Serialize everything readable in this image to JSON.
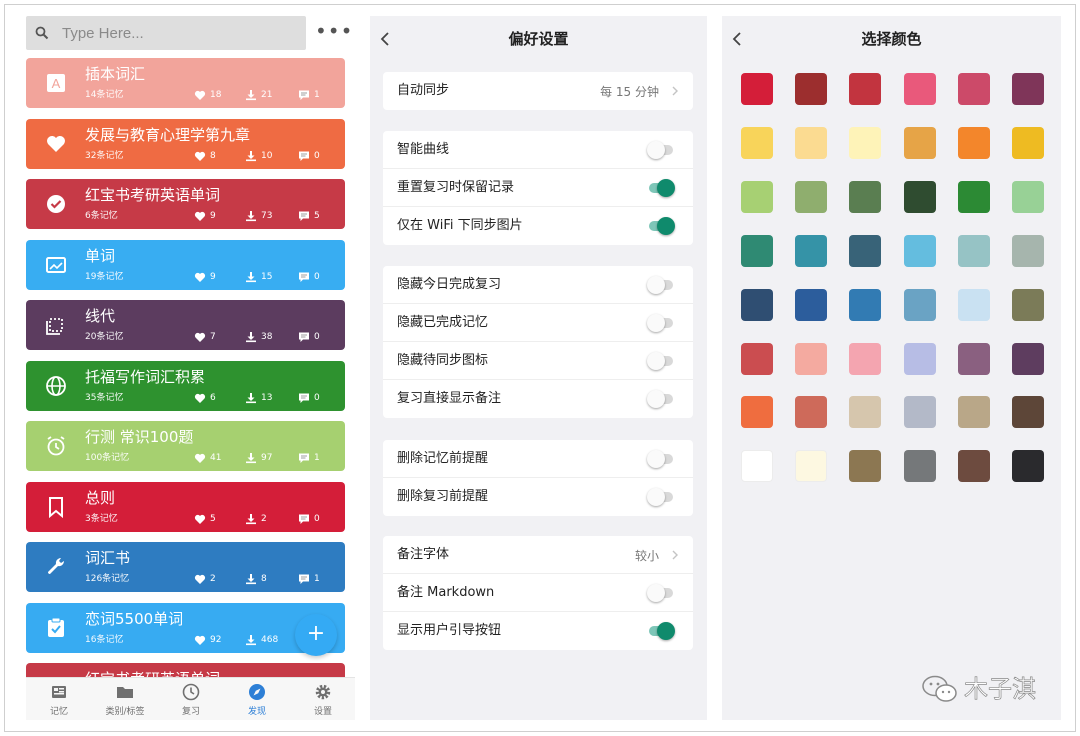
{
  "theme": {
    "accent": "#2d7fd6",
    "toggle_on": "#0f8a6c",
    "panel_bg": "#f1f1f4"
  },
  "deck_screen": {
    "search": {
      "placeholder": "Type Here..."
    },
    "more_icon": "more-dots-icon",
    "decks": [
      {
        "title": "插本词汇",
        "subtitle": "14条记忆",
        "likes": "18",
        "downloads": "21",
        "comments": "1",
        "color": "#f2a49b",
        "icon": "letter-a-icon"
      },
      {
        "title": "发展与教育心理学第九章",
        "subtitle": "32条记忆",
        "likes": "8",
        "downloads": "10",
        "comments": "0",
        "color": "#ef6b43",
        "icon": "heart-icon"
      },
      {
        "title": "红宝书考研英语单词",
        "subtitle": "6条记忆",
        "likes": "9",
        "downloads": "73",
        "comments": "5",
        "color": "#c63a47",
        "icon": "check-circle-icon"
      },
      {
        "title": "单词",
        "subtitle": "19条记忆",
        "likes": "9",
        "downloads": "15",
        "comments": "0",
        "color": "#38adf2",
        "icon": "image-icon"
      },
      {
        "title": "线代",
        "subtitle": "20条记忆",
        "likes": "7",
        "downloads": "38",
        "comments": "0",
        "color": "#5c3c5f",
        "icon": "crop-icon"
      },
      {
        "title": "托福写作词汇积累",
        "subtitle": "35条记忆",
        "likes": "6",
        "downloads": "13",
        "comments": "0",
        "color": "#2e922f",
        "icon": "globe-icon"
      },
      {
        "title": "行测 常识100题",
        "subtitle": "100条记忆",
        "likes": "41",
        "downloads": "97",
        "comments": "1",
        "color": "#a6d070",
        "icon": "alarm-icon"
      },
      {
        "title": "总则",
        "subtitle": "3条记忆",
        "likes": "5",
        "downloads": "2",
        "comments": "0",
        "color": "#d41e39",
        "icon": "bookmark-icon"
      },
      {
        "title": "词汇书",
        "subtitle": "126条记忆",
        "likes": "2",
        "downloads": "8",
        "comments": "1",
        "color": "#2e7cc1",
        "icon": "wrench-icon"
      },
      {
        "title": "恋词5500单词",
        "subtitle": "16条记忆",
        "likes": "92",
        "downloads": "468",
        "comments": "",
        "color": "#37abf2",
        "icon": "clipboard-check-icon"
      },
      {
        "title": "红宝书考研英语单词",
        "subtitle": "",
        "likes": "",
        "downloads": "",
        "comments": "",
        "color": "#c63a47",
        "icon": "check-circle-icon"
      }
    ],
    "fab": {
      "label": "+",
      "icon": "plus-icon"
    },
    "tabs": [
      {
        "label": "记忆",
        "icon": "cards-icon",
        "active": false
      },
      {
        "label": "类别/标签",
        "icon": "folder-icon",
        "active": false
      },
      {
        "label": "复习",
        "icon": "clock-icon",
        "active": false
      },
      {
        "label": "发现",
        "icon": "compass-icon",
        "active": true
      },
      {
        "label": "设置",
        "icon": "gear-icon",
        "active": false
      }
    ]
  },
  "preferences_screen": {
    "title": "偏好设置",
    "groups": [
      [
        {
          "label": "自动同步",
          "type": "value",
          "value": "每 15 分钟"
        }
      ],
      [
        {
          "label": "智能曲线",
          "type": "toggle",
          "on": false
        },
        {
          "label": "重置复习时保留记录",
          "type": "toggle",
          "on": true
        },
        {
          "label": "仅在 WiFi 下同步图片",
          "type": "toggle",
          "on": true
        }
      ],
      [
        {
          "label": "隐藏今日完成复习",
          "type": "toggle",
          "on": false
        },
        {
          "label": "隐藏已完成记忆",
          "type": "toggle",
          "on": false
        },
        {
          "label": "隐藏待同步图标",
          "type": "toggle",
          "on": false
        },
        {
          "label": "复习直接显示备注",
          "type": "toggle",
          "on": false
        }
      ],
      [
        {
          "label": "删除记忆前提醒",
          "type": "toggle",
          "on": false
        },
        {
          "label": "删除复习前提醒",
          "type": "toggle",
          "on": false
        }
      ],
      [
        {
          "label": "备注字体",
          "type": "value",
          "value": "较小"
        },
        {
          "label": "备注 Markdown",
          "type": "toggle",
          "on": false
        },
        {
          "label": "显示用户引导按钮",
          "type": "toggle",
          "on": true
        }
      ]
    ]
  },
  "color_screen": {
    "title": "选择颜色",
    "colors": [
      [
        "#d41e39",
        "#9c2e2e",
        "#c2343f",
        "#e9597b",
        "#cc4a69",
        "#7f3559"
      ],
      [
        "#f8d45a",
        "#fbdb91",
        "#fef3b8",
        "#e6a447",
        "#f3862b",
        "#eebb22"
      ],
      [
        "#a7d073",
        "#8fae6e",
        "#5a7e51",
        "#2f4c30",
        "#2c8a34",
        "#98d196"
      ],
      [
        "#2f8a73",
        "#3593a7",
        "#386378",
        "#64bddf",
        "#96c3c5",
        "#a6b5ad"
      ],
      [
        "#2f4e72",
        "#2c5d9c",
        "#327bb3",
        "#6aa3c4",
        "#c9e1f2",
        "#7b7b58"
      ],
      [
        "#cb4d50",
        "#f4aaa0",
        "#f4a5b0",
        "#b7bde5",
        "#8a6080",
        "#5e3d5f"
      ],
      [
        "#ef6d3f",
        "#ce6a5a",
        "#d6c6ad",
        "#b3b9c8",
        "#b9a788",
        "#5d4638"
      ],
      [
        "#ffffff",
        "#fdf8e1",
        "#8c7752",
        "#75787a",
        "#6d4b3f",
        "#2a2a2d"
      ]
    ]
  },
  "watermark": {
    "text": "木子淇",
    "icon": "wechat-logo-icon"
  }
}
